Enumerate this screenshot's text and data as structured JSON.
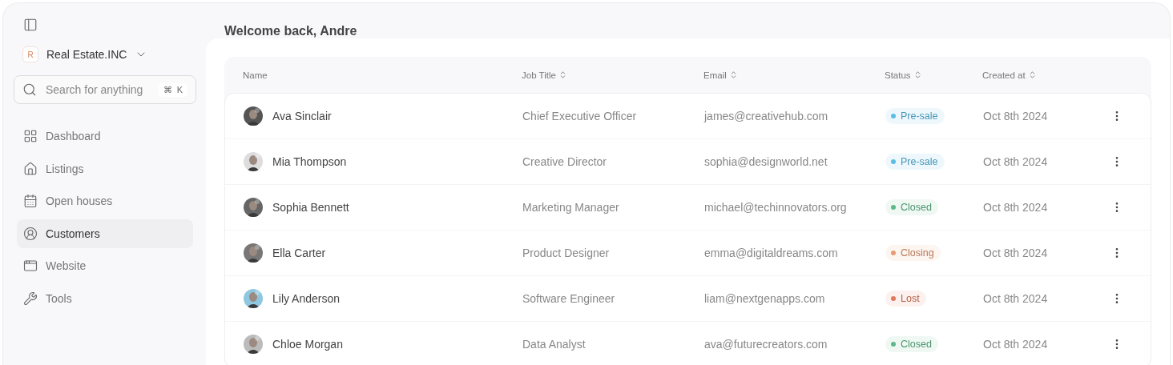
{
  "sidebar": {
    "workspace": {
      "initial": "R",
      "name": "Real Estate.INC"
    },
    "search": {
      "placeholder": "Search for anything",
      "shortcut_symbol": "⌘",
      "shortcut_key": "K"
    },
    "items": [
      {
        "kind": "dashboard",
        "label": "Dashboard",
        "selected": false
      },
      {
        "kind": "listings",
        "label": "Listings",
        "selected": false
      },
      {
        "kind": "calendar",
        "label": "Open houses",
        "selected": false
      },
      {
        "kind": "customers",
        "label": "Customers",
        "selected": true
      },
      {
        "kind": "website",
        "label": "Website",
        "selected": false
      },
      {
        "kind": "tools",
        "label": "Tools",
        "selected": false
      }
    ]
  },
  "header": {
    "title": "Welcome back, Andre"
  },
  "table": {
    "columns": [
      {
        "label": "Name",
        "sortable": false
      },
      {
        "label": "Job Title",
        "sortable": true
      },
      {
        "label": "Email",
        "sortable": true
      },
      {
        "label": "Status",
        "sortable": true
      },
      {
        "label": "Created at",
        "sortable": true
      }
    ],
    "rows": [
      {
        "name": "Ava Sinclair",
        "job_title": "Chief Executive Officer",
        "email": "james@creativehub.com",
        "status": {
          "label": "Pre-sale",
          "color": "#5bbde6"
        },
        "created_at": "Oct 8th 2024"
      },
      {
        "name": "Mia Thompson",
        "job_title": "Creative Director",
        "email": "sophia@designworld.net",
        "status": {
          "label": "Pre-sale",
          "color": "#5bbde6"
        },
        "created_at": "Oct 8th 2024"
      },
      {
        "name": "Sophia Bennett",
        "job_title": "Marketing Manager",
        "email": "michael@techinnovators.org",
        "status": {
          "label": "Closed",
          "color": "#5fb88a"
        },
        "created_at": "Oct 8th 2024"
      },
      {
        "name": "Ella Carter",
        "job_title": "Product Designer",
        "email": "emma@digitaldreams.com",
        "status": {
          "label": "Closing",
          "color": "#e89a70"
        },
        "created_at": "Oct 8th 2024"
      },
      {
        "name": "Lily Anderson",
        "job_title": "Software Engineer",
        "email": "liam@nextgenapps.com",
        "status": {
          "label": "Lost",
          "color": "#e0785a"
        },
        "created_at": "Oct 8th 2024"
      },
      {
        "name": "Chloe Morgan",
        "job_title": "Data Analyst",
        "email": "ava@futurecreators.com",
        "status": {
          "label": "Closed",
          "color": "#5fb88a"
        },
        "created_at": "Oct 8th 2024"
      }
    ]
  }
}
